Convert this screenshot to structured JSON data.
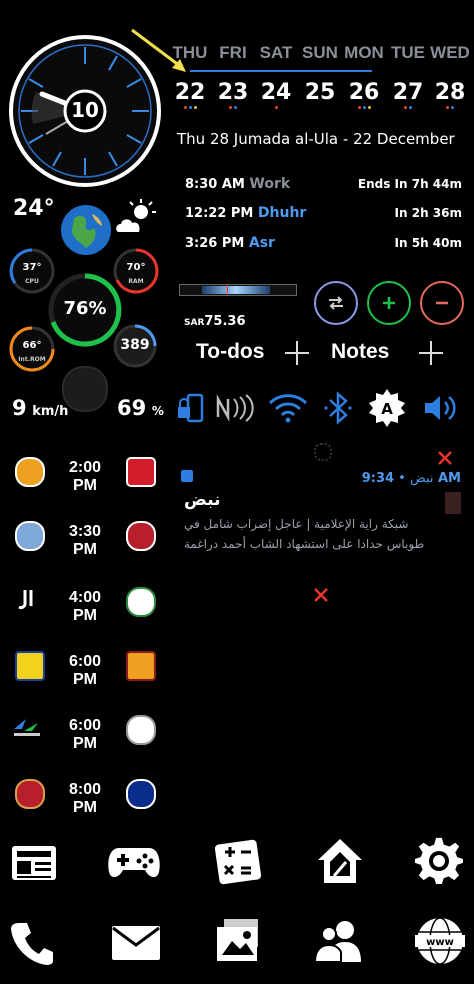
{
  "calendar": {
    "days": [
      {
        "name": "THU",
        "num": "22"
      },
      {
        "name": "FRI",
        "num": "23"
      },
      {
        "name": "SAT",
        "num": "24"
      },
      {
        "name": "SUN",
        "num": "25"
      },
      {
        "name": "MON",
        "num": "26"
      },
      {
        "name": "TUE",
        "num": "27"
      },
      {
        "name": "WED",
        "num": "28"
      }
    ],
    "hijri_line": "Thu 28 Jumada al-Ula - 22 December"
  },
  "clock": {
    "center_number": "10"
  },
  "prayer": [
    {
      "time": "8:30 AM",
      "name": "Work",
      "remain": "Ends In 7h 44m"
    },
    {
      "time": "12:22 PM",
      "name": "Dhuhr",
      "remain": "In 2h 36m"
    },
    {
      "time": "3:26 PM",
      "name": "Asr",
      "remain": "In 5h 40m"
    }
  ],
  "weather": {
    "temp": "24°"
  },
  "stats": {
    "cpu_value": "37°",
    "cpu_label": "CPU",
    "ram_value": "70°",
    "ram_label": "RAM",
    "battery": "76%",
    "rom_value": "66°",
    "rom_label": "Int.ROM",
    "count": "389",
    "wind": "9",
    "wind_unit": "km/h",
    "humidity": "69",
    "humidity_unit": "%"
  },
  "balance": {
    "currency": "SAR",
    "amount": "75.36"
  },
  "notes": {
    "todos_label": "To-dos",
    "notes_label": "Notes"
  },
  "notification": {
    "time": "9:34 AM",
    "app": "نبض",
    "title": "نبض",
    "line1": "شبكة راية الإعلامية | عاجل إضراب شامل في",
    "line2": "طوباس حدادا على استشهاد الشاب أحمد دراغمة"
  },
  "matches": [
    {
      "time": "2:00 PM"
    },
    {
      "time": "3:30 PM"
    },
    {
      "time": "4:00 PM"
    },
    {
      "time": "6:00 PM"
    },
    {
      "time": "6:00 PM"
    },
    {
      "time": "8:00 PM"
    }
  ],
  "colors": {
    "accent_blue": "#2e7de0",
    "green": "#1ec24b",
    "red": "#e8352c",
    "orange": "#f08a1c",
    "gray_text": "#8a8f99"
  }
}
